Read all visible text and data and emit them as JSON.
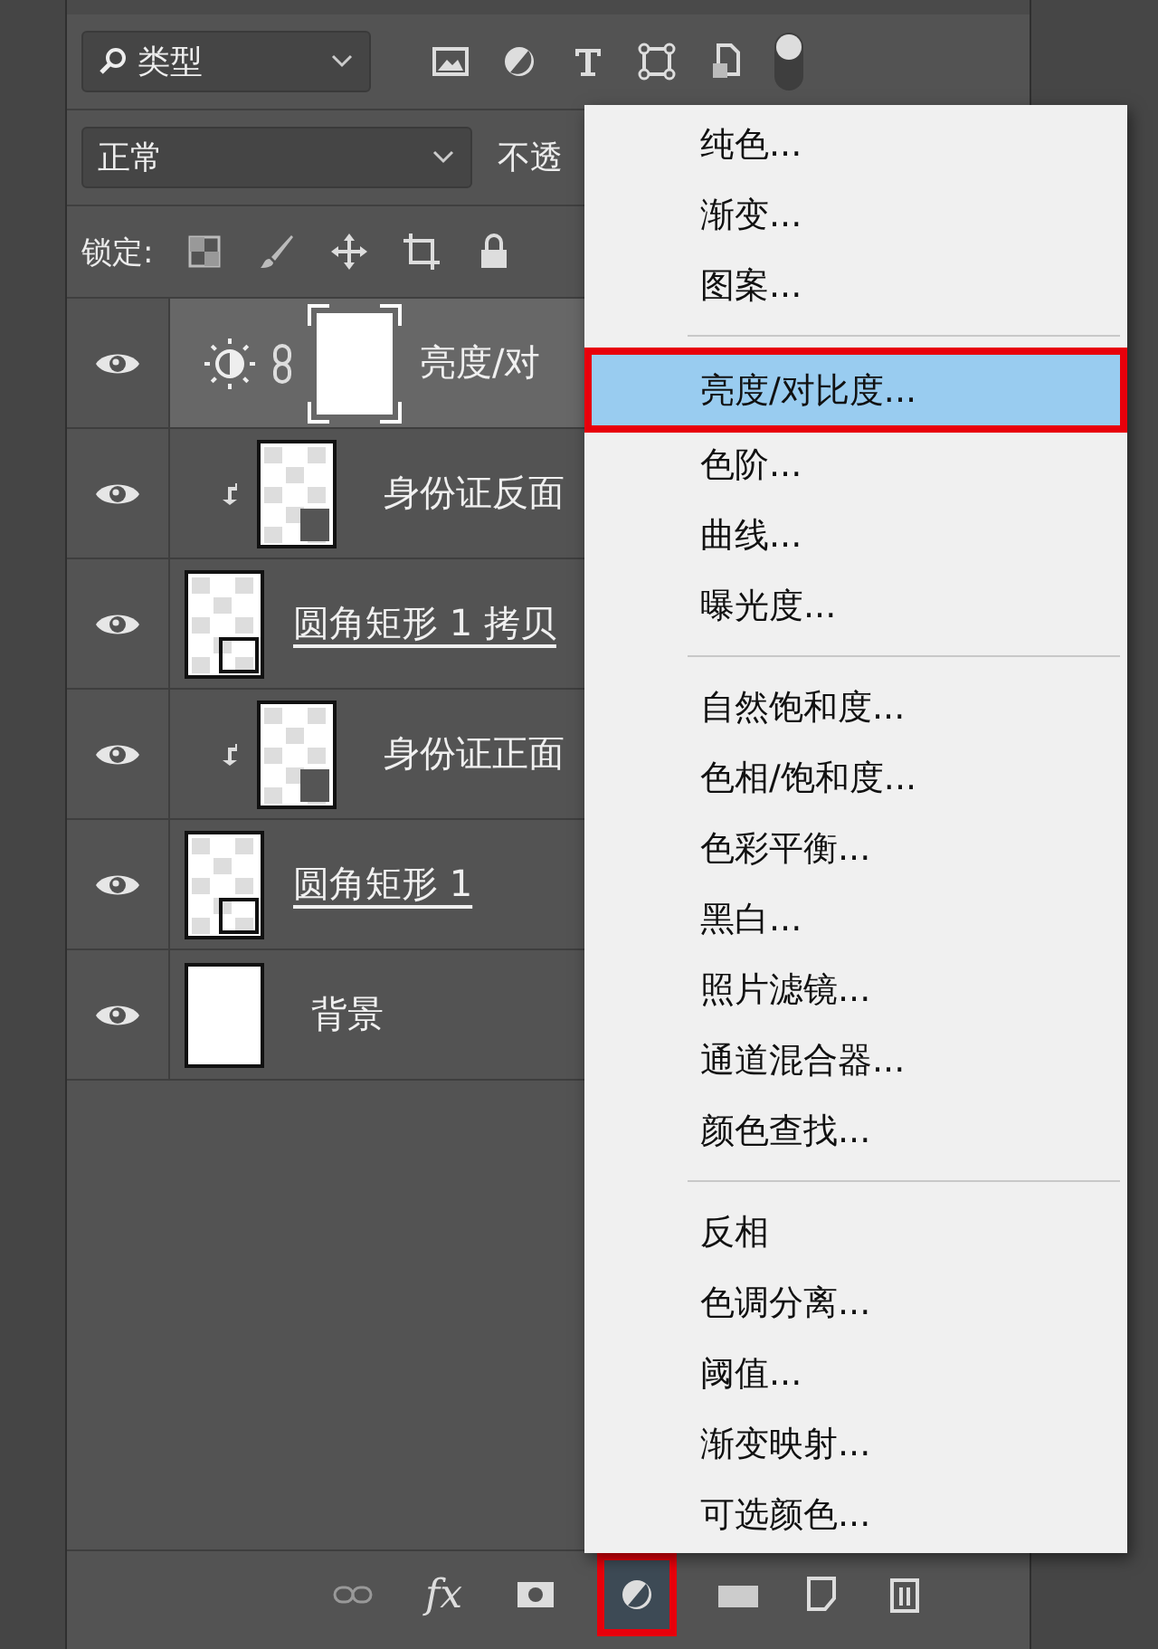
{
  "filter_bar": {
    "kind_select": "类型",
    "pixel_filter_on": true
  },
  "blend_bar": {
    "mode": "正常",
    "opacity_label": "不透"
  },
  "lock_bar": {
    "label": "锁定:"
  },
  "layers": [
    {
      "kind": "adjustment",
      "name": "亮度/对",
      "selected": true,
      "visible": true,
      "clipped": false
    },
    {
      "kind": "smart",
      "name": "身份证反面",
      "selected": false,
      "visible": true,
      "clipped": true
    },
    {
      "kind": "shape",
      "name": "圆角矩形 1 拷贝",
      "selected": false,
      "visible": true,
      "clipped": false
    },
    {
      "kind": "smart",
      "name": "身份证正面",
      "selected": false,
      "visible": true,
      "clipped": true
    },
    {
      "kind": "shape",
      "name": "圆角矩形 1",
      "selected": false,
      "visible": true,
      "clipped": false
    },
    {
      "kind": "background",
      "name": "背景",
      "selected": false,
      "visible": true,
      "clipped": false
    }
  ],
  "adjustment_menu": {
    "groups": [
      [
        {
          "label": "纯色...",
          "selected": false
        },
        {
          "label": "渐变...",
          "selected": false
        },
        {
          "label": "图案...",
          "selected": false
        }
      ],
      [
        {
          "label": "亮度/对比度...",
          "selected": true
        },
        {
          "label": "色阶...",
          "selected": false
        },
        {
          "label": "曲线...",
          "selected": false
        },
        {
          "label": "曝光度...",
          "selected": false
        }
      ],
      [
        {
          "label": "自然饱和度...",
          "selected": false
        },
        {
          "label": "色相/饱和度...",
          "selected": false
        },
        {
          "label": "色彩平衡...",
          "selected": false
        },
        {
          "label": "黑白...",
          "selected": false
        },
        {
          "label": "照片滤镜...",
          "selected": false
        },
        {
          "label": "通道混合器...",
          "selected": false
        },
        {
          "label": "颜色查找...",
          "selected": false
        }
      ],
      [
        {
          "label": "反相",
          "selected": false
        },
        {
          "label": "色调分离...",
          "selected": false
        },
        {
          "label": "阈值...",
          "selected": false
        },
        {
          "label": "渐变映射...",
          "selected": false
        },
        {
          "label": "可选颜色...",
          "selected": false
        }
      ]
    ]
  },
  "bottom_bar": {
    "fx_label": "fx",
    "adjustment_button_active": true
  }
}
